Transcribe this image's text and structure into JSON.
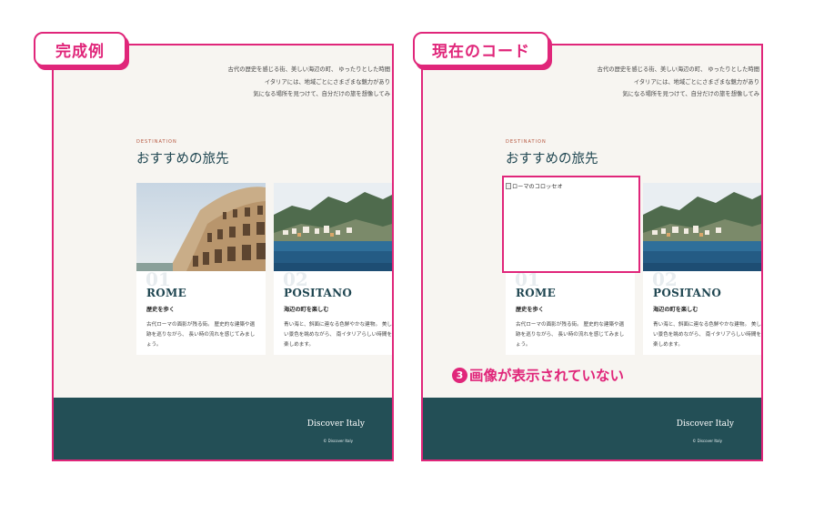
{
  "labels": {
    "completed": "完成例",
    "current": "現在のコード"
  },
  "intro": {
    "line1": "古代の歴史を感じる街、美しい海辺の町、 ゆったりとした時間",
    "line2": "イタリアには、地域ごとにさまざまな魅力があり",
    "line3": "気になる場所を見つけて、自分だけの旅を想像してみ"
  },
  "section": {
    "kicker": "DESTINATION",
    "title": "おすすめの旅先"
  },
  "cards": [
    {
      "num": "01",
      "city": "ROME",
      "sub": "歴史を歩く",
      "desc": "古代ローマの面影が残る街。 歴史的な建築や遺跡を巡りながら、 長い時の流れを感じてみましょう。",
      "alt": "ローマのコロッセオ"
    },
    {
      "num": "02",
      "city": "POSITANO",
      "sub": "海辺の町を楽しむ",
      "desc": "青い海と、斜面に連なる色鮮やかな建物。 美しい景色を眺めながら、 南イタリアらしい時間を楽しめます。"
    }
  ],
  "footer": {
    "brand": "Discover Italy",
    "copy": "© Discover Italy"
  },
  "note": {
    "num": "3",
    "text": "画像が表示されていない"
  },
  "colors": {
    "accent": "#e0267a",
    "heading": "#1f4651",
    "footer": "#234f56",
    "page": "#f7f5f1"
  }
}
